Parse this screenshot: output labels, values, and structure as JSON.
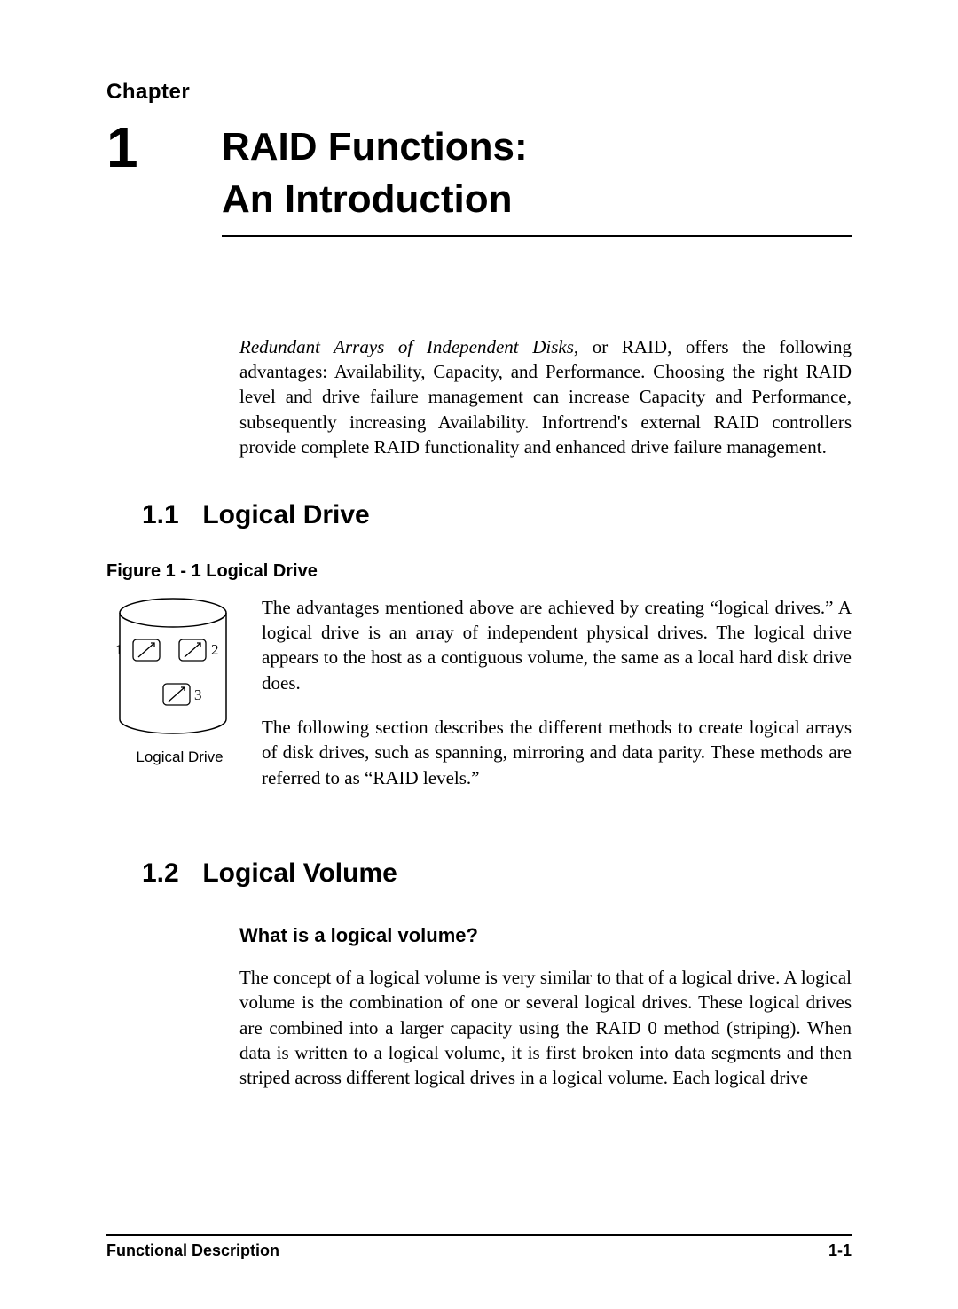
{
  "chapter": {
    "label": "Chapter",
    "number": "1",
    "title_line1": "RAID Functions:",
    "title_line2": "An Introduction"
  },
  "intro": {
    "italic_lead": "Redundant Arrays of Independent Disks",
    "rest": ", or RAID, offers the following advantages: Availability, Capacity, and Performance.  Choosing the right RAID level and drive failure management can increase Capacity and Performance, subsequently increasing Availability.  Infortrend's external RAID controllers provide complete RAID functionality and enhanced drive failure management."
  },
  "section1": {
    "number": "1.1",
    "title": "Logical Drive",
    "figure_caption": "Figure 1 - 1 Logical Drive",
    "figure_label": "Logical Drive",
    "disk_labels": {
      "d1": "1",
      "d2": "2",
      "d3": "3"
    },
    "para1": "The advantages mentioned above are achieved by creating “logical drives.”   A logical drive is an array of independent physical drives.  The logical drive appears to the host as a contiguous volume, the same as a local hard disk drive does.",
    "para2": "The following section describes the different methods to create logical arrays of disk drives, such as spanning, mirroring and data parity.  These methods are referred to as “RAID levels.”"
  },
  "section2": {
    "number": "1.2",
    "title": "Logical Volume",
    "subheading": "What is a logical volume?",
    "para": "The concept of a logical volume is very similar to that of a logical drive.  A logical volume is the combination of one or several logical drives.  These logical drives are combined into a larger capacity using the RAID 0 method (striping).  When data is written to a logical volume, it is first broken into data segments and then striped across different logical drives in a logical volume.  Each logical drive"
  },
  "footer": {
    "left": "Functional Description",
    "right": "1-1"
  }
}
